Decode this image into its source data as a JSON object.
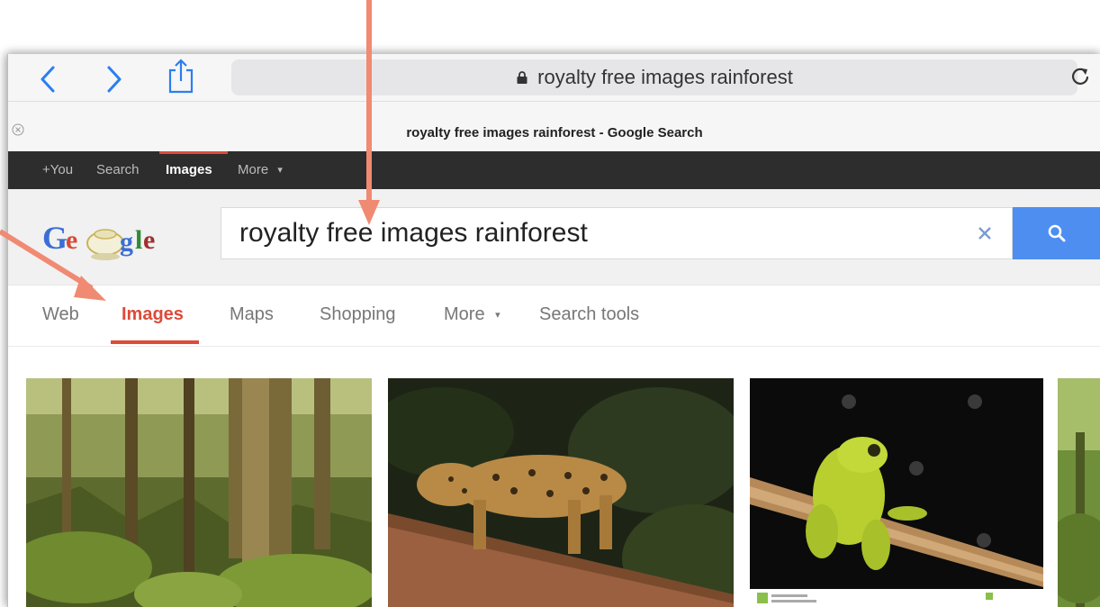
{
  "browser": {
    "url_text": "royalty free images rainforest",
    "tab_title": "royalty free images rainforest - Google Search"
  },
  "gbar": {
    "items": [
      {
        "label": "+You"
      },
      {
        "label": "Search"
      },
      {
        "label": "Images"
      },
      {
        "label": "More"
      }
    ]
  },
  "search": {
    "query": "royalty free images rainforest"
  },
  "result_tabs": [
    {
      "label": "Web"
    },
    {
      "label": "Images"
    },
    {
      "label": "Maps"
    },
    {
      "label": "Shopping"
    },
    {
      "label": "More"
    },
    {
      "label": "Search tools"
    }
  ],
  "results": [
    {
      "subject": "rainforest trees"
    },
    {
      "subject": "jaguar on log"
    },
    {
      "subject": "green tree frog"
    },
    {
      "subject": "forest"
    }
  ],
  "colors": {
    "accent_red": "#dd4b39",
    "search_blue": "#4d8ef0",
    "annotation": "#f08a72",
    "link_blue": "#2a7ef0"
  }
}
